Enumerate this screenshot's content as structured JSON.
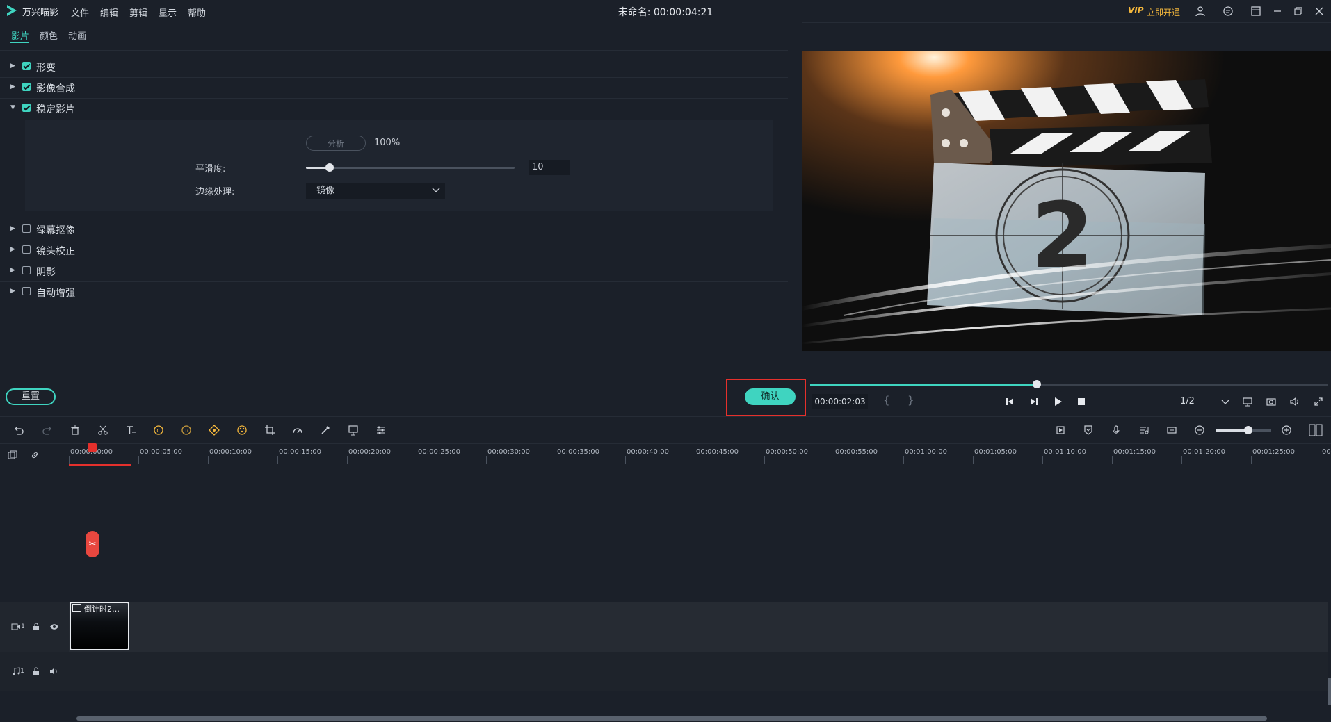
{
  "app": {
    "name": "万兴喵影",
    "menu": [
      "文件",
      "编辑",
      "剪辑",
      "显示",
      "帮助"
    ],
    "doc_title": "未命名: 00:00:04:21",
    "vip_badge": "VIP",
    "vip_text": "立即开通"
  },
  "props": {
    "tabs": [
      "影片",
      "颜色",
      "动画"
    ],
    "active_tab": "影片",
    "sections": [
      {
        "label": "形变",
        "checked": true,
        "expanded": false
      },
      {
        "label": "影像合成",
        "checked": true,
        "expanded": false
      },
      {
        "label": "稳定影片",
        "checked": true,
        "expanded": true
      },
      {
        "label": "绿幕抠像",
        "checked": false,
        "expanded": false
      },
      {
        "label": "镜头校正",
        "checked": false,
        "expanded": false
      },
      {
        "label": "阴影",
        "checked": false,
        "expanded": false
      },
      {
        "label": "自动增强",
        "checked": false,
        "expanded": false
      }
    ],
    "stabilize": {
      "analyze_label": "分析",
      "analyze_progress": "100%",
      "smoothness_label": "平滑度:",
      "smoothness_value": "10",
      "edge_label": "边缘处理:",
      "edge_value": "镜像"
    },
    "reset_label": "重置",
    "ok_label": "确认"
  },
  "preview": {
    "clap_number": "2",
    "timecode": "00:00:02:03",
    "brace_open": "{",
    "brace_close": "}",
    "ratio": "1/2",
    "progress": 0.44
  },
  "timeline": {
    "ruler_labels": [
      "00:00:00:00",
      "00:00:05:00",
      "00:00:10:00",
      "00:00:15:00",
      "00:00:20:00",
      "00:00:25:00",
      "00:00:30:00",
      "00:00:35:00",
      "00:00:40:00",
      "00:00:45:00",
      "00:00:50:00",
      "00:00:55:00",
      "00:01:00:00",
      "00:01:05:00",
      "00:01:10:00",
      "00:01:15:00",
      "00:01:20:00",
      "00:01:25:00",
      "00:"
    ],
    "clip_title": "倒计时2…",
    "video_track_label": "1",
    "audio_track_label": "1"
  },
  "colors": {
    "accent": "#3fd4c0",
    "playhead": "#e5302c",
    "highlight_box": "#e5302c",
    "vip": "#f4b73c"
  }
}
